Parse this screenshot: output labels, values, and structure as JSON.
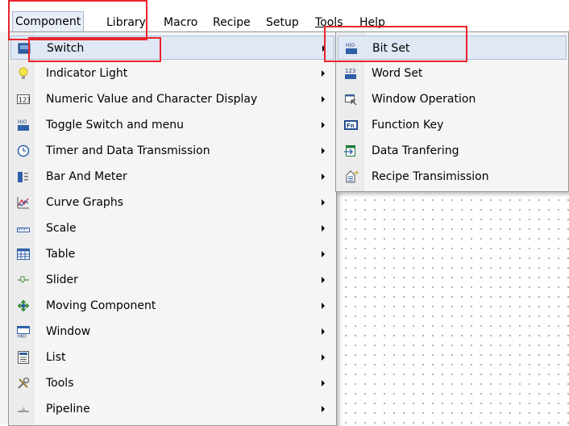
{
  "menubar": {
    "items": [
      {
        "label": "Component",
        "active": true
      },
      {
        "label": "Library"
      },
      {
        "label": "Macro"
      },
      {
        "label": "Recipe"
      },
      {
        "label": "Setup"
      },
      {
        "label": "Tools"
      },
      {
        "label": "Help"
      }
    ]
  },
  "component_menu": {
    "items": [
      {
        "label": "Switch",
        "icon": "switch-icon",
        "highlighted": true
      },
      {
        "label": "Indicator Light",
        "icon": "bulb-icon"
      },
      {
        "label": "Numeric Value and Character Display",
        "icon": "numeric-123-icon"
      },
      {
        "label": "Toggle Switch and menu",
        "icon": "toggle-icon"
      },
      {
        "label": "Timer and Data Transmission",
        "icon": "clock-icon"
      },
      {
        "label": "Bar And Meter",
        "icon": "bar-meter-icon"
      },
      {
        "label": "Curve Graphs",
        "icon": "curve-graph-icon"
      },
      {
        "label": "Scale",
        "icon": "scale-icon"
      },
      {
        "label": "Table",
        "icon": "table-icon"
      },
      {
        "label": "Slider",
        "icon": "slider-icon"
      },
      {
        "label": "Moving Component",
        "icon": "move-icon"
      },
      {
        "label": "Window",
        "icon": "window-icon"
      },
      {
        "label": "List",
        "icon": "list-icon"
      },
      {
        "label": "Tools",
        "icon": "tools-icon"
      },
      {
        "label": "Pipeline",
        "icon": "pipeline-icon"
      }
    ]
  },
  "switch_submenu": {
    "items": [
      {
        "label": "Bit Set",
        "icon": "bit-set-icon",
        "highlighted": true
      },
      {
        "label": "Word Set",
        "icon": "word-set-icon"
      },
      {
        "label": "Window Operation",
        "icon": "window-operation-icon"
      },
      {
        "label": "Function Key",
        "icon": "function-key-icon"
      },
      {
        "label": "Data Tranfering",
        "icon": "data-transfer-icon"
      },
      {
        "label": "Recipe Transimission",
        "icon": "recipe-transmission-icon"
      }
    ]
  },
  "colors": {
    "annotation": "#e8242b",
    "highlight": "#dfe8f4",
    "menu_bg": "#f5f5f5"
  }
}
